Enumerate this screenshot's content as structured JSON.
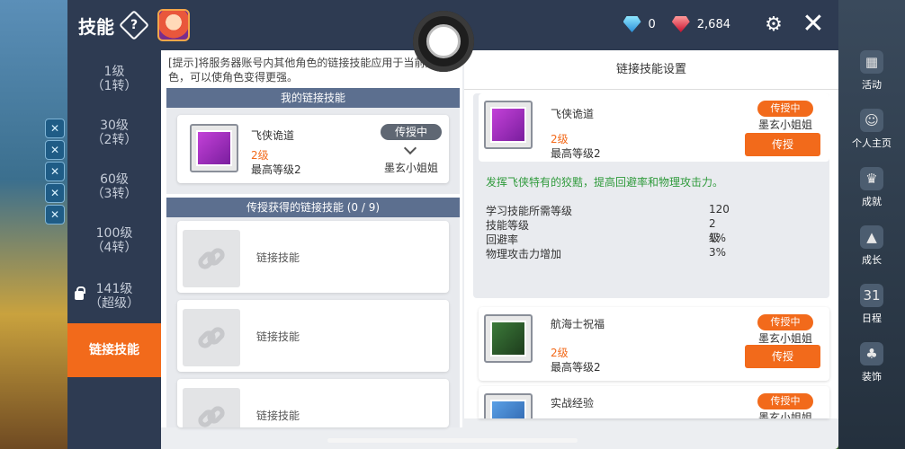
{
  "header": {
    "title": "技能",
    "help_icon": "help-diamond-icon",
    "diamond_count": "0",
    "ruby_count": "2,684",
    "colors": {
      "bar": "#2e3b52",
      "accent": "#f26a1b"
    }
  },
  "level_tabs": [
    {
      "line1": "1级",
      "line2": "（1转）",
      "active": false
    },
    {
      "line1": "30级",
      "line2": "（2转）",
      "active": false
    },
    {
      "line1": "60级",
      "line2": "（3转）",
      "active": false
    },
    {
      "line1": "100级",
      "line2": "（4转）",
      "active": false
    },
    {
      "line1": "141级",
      "line2": "（超级）",
      "active": false,
      "locked": true
    },
    {
      "line1": "链接技能",
      "line2": "",
      "active": true
    }
  ],
  "middle": {
    "hint": "[提示]将服务器账号内其他角色的链接技能应用于当前角色，可以使角色变得更强。",
    "my_link_header": "我的链接技能",
    "my_skill": {
      "name": "飞侠诡道",
      "level": "2级",
      "max": "最高等级2",
      "status_badge": "传授中",
      "owner": "墨玄小姐姐"
    },
    "received_header": "传授获得的链接技能 (0 / 9)",
    "empty_slots": [
      "链接技能",
      "链接技能",
      "链接技能"
    ]
  },
  "right": {
    "header": "链接技能设置",
    "selected": {
      "name": "飞侠诡道",
      "level": "2级",
      "max": "最高等级2",
      "status_badge": "传授中",
      "owner": "墨玄小姐姐",
      "teach_button": "传授",
      "description": "发挥飞侠特有的狡黠，提高回避率和物理攻击力。",
      "stats": [
        {
          "label": "学习技能所需等级",
          "value": "120"
        },
        {
          "label": "技能等级",
          "value": "2级"
        },
        {
          "label": "回避率",
          "value": "1%"
        },
        {
          "label": "物理攻击力增加",
          "value": "3%"
        }
      ]
    },
    "others": [
      {
        "name": "航海士祝福",
        "level": "2级",
        "max": "最高等级2",
        "status_badge": "传授中",
        "owner": "墨玄小姐姐",
        "teach_button": "传授"
      },
      {
        "name": "实战经验",
        "status_badge": "传授中",
        "owner": "墨玄小姐姐"
      }
    ]
  },
  "right_sidebar": [
    {
      "label": "活动",
      "icon": "calendar-icon"
    },
    {
      "label": "个人主页",
      "icon": "profile-icon"
    },
    {
      "label": "成就",
      "icon": "trophy-icon"
    },
    {
      "label": "成长",
      "icon": "growth-icon"
    },
    {
      "label": "日程",
      "icon": "schedule-icon"
    },
    {
      "label": "装饰",
      "icon": "decor-icon"
    }
  ]
}
